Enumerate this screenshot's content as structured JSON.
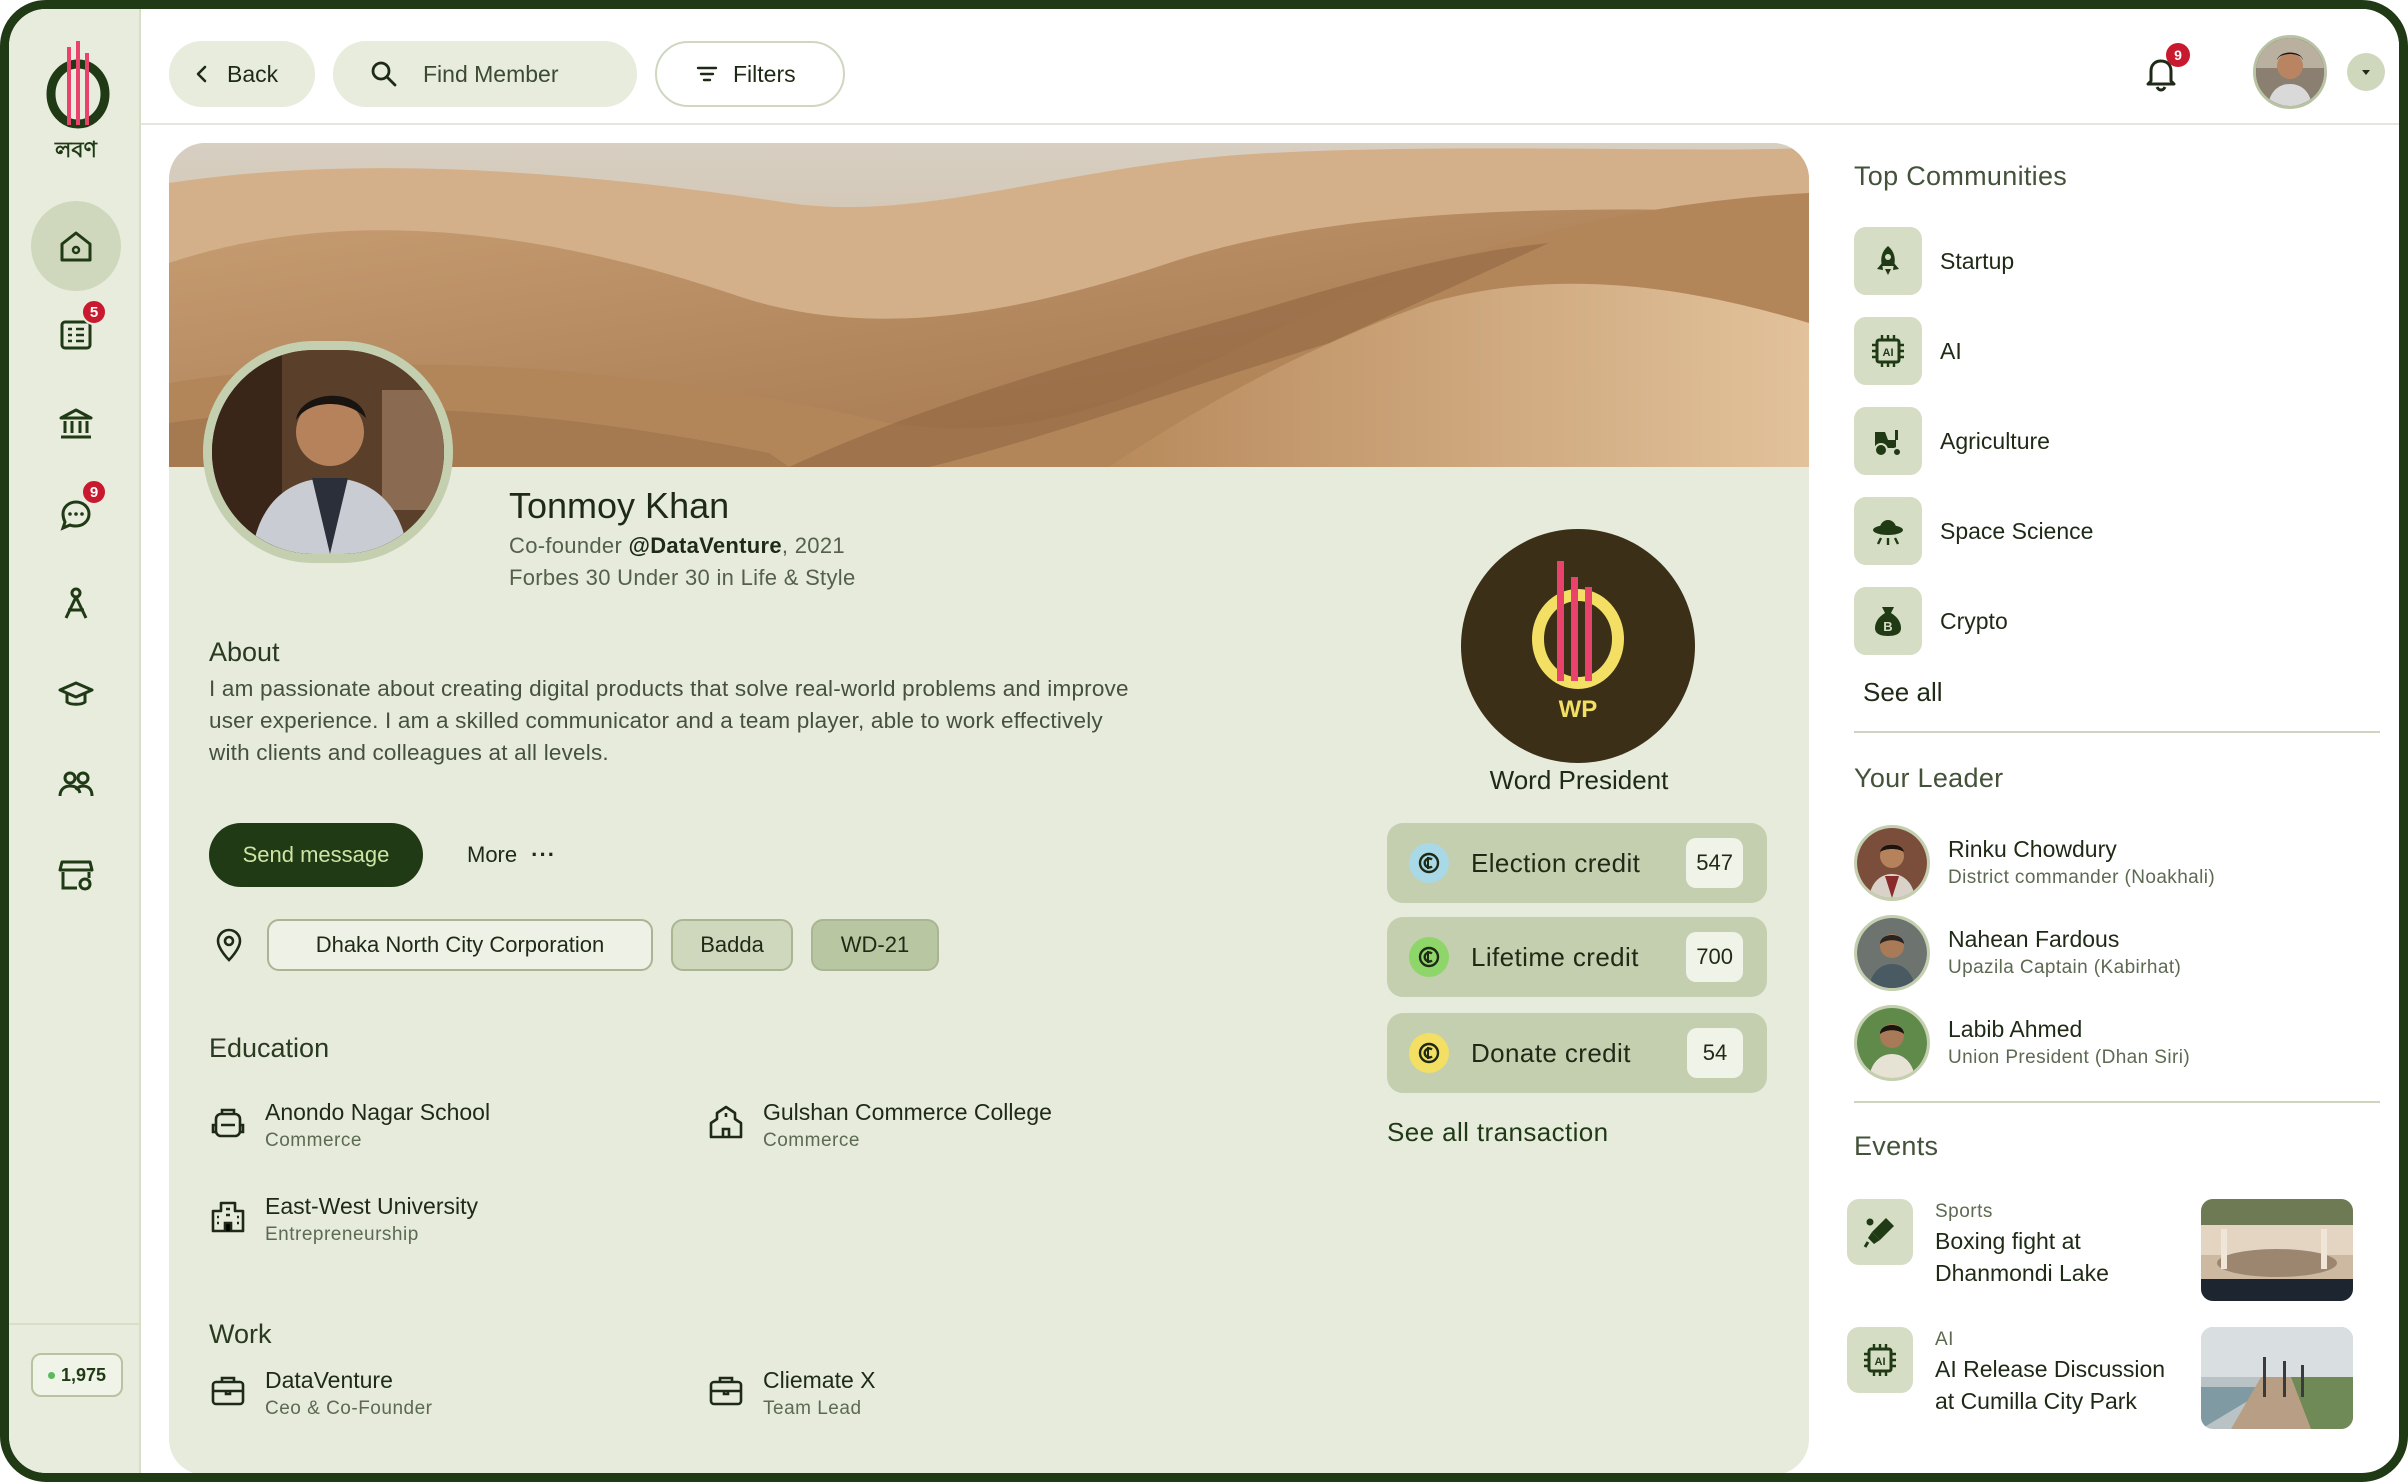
{
  "app": {
    "logo_text": "লবণ"
  },
  "sidebar": {
    "items": [
      {
        "name": "home",
        "badge": ""
      },
      {
        "name": "news",
        "badge": "5"
      },
      {
        "name": "institution",
        "badge": ""
      },
      {
        "name": "chat",
        "badge": "9"
      },
      {
        "name": "campaign",
        "badge": ""
      },
      {
        "name": "education",
        "badge": ""
      },
      {
        "name": "community",
        "badge": ""
      },
      {
        "name": "store",
        "badge": ""
      }
    ],
    "count": "1,975"
  },
  "topbar": {
    "back_label": "Back",
    "search_placeholder": "Find Member",
    "filters_label": "Filters",
    "notification_count": "9"
  },
  "profile": {
    "name": "Tonmoy Khan",
    "role_prefix": "Co-founder ",
    "company": "@DataVenture",
    "year": ", 2021",
    "award": "Forbes 30 Under 30 in Life & Style",
    "about_title": "About",
    "about_text": "I am passionate about creating digital products that solve real-world problems and improve user experience. I am a skilled communicator and a team player, able to work effectively with clients and colleagues at all levels.",
    "send_message_label": "Send message",
    "more_label": "More",
    "more_dots": "···",
    "tags": [
      "Dhaka North City Corporation",
      "Badda",
      "WD-21"
    ],
    "education_title": "Education",
    "education": [
      {
        "school": "Anondo Nagar School",
        "field": "Commerce"
      },
      {
        "school": "Gulshan Commerce College",
        "field": "Commerce"
      },
      {
        "school": "East-West University",
        "field": "Entrepreneurship"
      }
    ],
    "work_title": "Work",
    "work": [
      {
        "company": "DataVenture",
        "role": "Ceo & Co-Founder"
      },
      {
        "company": "Cliemate X",
        "role": "Team Lead"
      }
    ]
  },
  "badge": {
    "code": "WP",
    "title": "Word President",
    "credits": [
      {
        "label": "Election credit",
        "value": "547",
        "color": "#a9d8e6"
      },
      {
        "label": "Lifetime credit",
        "value": "700",
        "color": "#8fd66a"
      },
      {
        "label": "Donate credit",
        "value": "54",
        "color": "#f2df63"
      }
    ],
    "see_all_transaction": "See all transaction"
  },
  "communities": {
    "title": "Top Communities",
    "items": [
      {
        "label": "Startup",
        "icon": "rocket-icon"
      },
      {
        "label": "AI",
        "icon": "ai-chip-icon"
      },
      {
        "label": "Agriculture",
        "icon": "tractor-icon"
      },
      {
        "label": "Space Science",
        "icon": "ufo-icon"
      },
      {
        "label": "Crypto",
        "icon": "money-bag-icon"
      }
    ],
    "see_all": "See all"
  },
  "leaders": {
    "title": "Your Leader",
    "items": [
      {
        "name": "Rinku Chowdury",
        "role": "District commander (Noakhali)"
      },
      {
        "name": "Nahean Fardous",
        "role": "Upazila Captain (Kabirhat)"
      },
      {
        "name": "Labib Ahmed",
        "role": "Union President (Dhan Siri)"
      }
    ]
  },
  "events": {
    "title": "Events",
    "items": [
      {
        "category": "Sports",
        "title": "Boxing fight at Dhanmondi Lake",
        "icon": "cricket-bat-icon"
      },
      {
        "category": "AI",
        "title": "AI Release Discussion at Cumilla City Park",
        "icon": "ai-chip-icon"
      }
    ]
  },
  "colors": {
    "brand_dark": "#1f3a14",
    "panel": "#e6ebdc",
    "accent_pink": "#e8426d",
    "accent_yellow": "#f2df63",
    "badge_red": "#c8192e"
  }
}
